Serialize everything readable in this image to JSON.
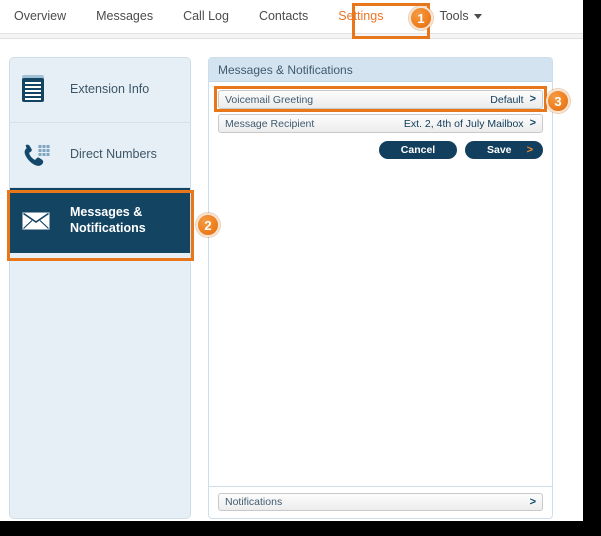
{
  "colors": {
    "accent_orange": "#e8761b",
    "badge_orange": "#ef8120",
    "navy": "#134563",
    "panel_header_bg": "#d3e3ef",
    "sidebar_bg": "#e7eff6",
    "active_tab_text": "#ec7525",
    "nav_text": "#4b4b4b"
  },
  "topnav": {
    "items": [
      {
        "label": "Overview",
        "active": false,
        "icon": ""
      },
      {
        "label": "Messages",
        "active": false,
        "icon": ""
      },
      {
        "label": "Call Log",
        "active": false,
        "icon": ""
      },
      {
        "label": "Contacts",
        "active": false,
        "icon": ""
      },
      {
        "label": "Settings",
        "active": true,
        "icon": ""
      },
      {
        "label": "Tools",
        "active": false,
        "icon": "caret-down-icon"
      }
    ]
  },
  "sidebar": {
    "items": [
      {
        "label": "Extension Info",
        "icon": "document-lines-icon",
        "selected": false
      },
      {
        "label": "Direct Numbers",
        "icon": "phone-keypad-icon",
        "selected": false
      },
      {
        "label": "Messages & Notifications",
        "label_line1": "Messages &",
        "label_line2": "Notifications",
        "icon": "envelope-icon",
        "selected": true
      }
    ]
  },
  "panel": {
    "header": "Messages & Notifications",
    "rows": [
      {
        "name": "Voicemail Greeting",
        "value": "Default",
        "chevron": ">",
        "highlighted": true
      },
      {
        "name": "Message Recipient",
        "value": "Ext. 2, 4th of July Mailbox",
        "chevron": ">",
        "highlighted": false
      }
    ],
    "buttons": {
      "cancel": "Cancel",
      "save": "Save",
      "save_chevron": ">"
    },
    "footer_row": {
      "name": "Notifications",
      "value": "",
      "chevron": ">"
    }
  },
  "badges": [
    {
      "number": "1",
      "target": "settings-tab"
    },
    {
      "number": "2",
      "target": "sidebar-item-messages-notifications"
    },
    {
      "number": "3",
      "target": "voicemail-greeting-row"
    }
  ]
}
